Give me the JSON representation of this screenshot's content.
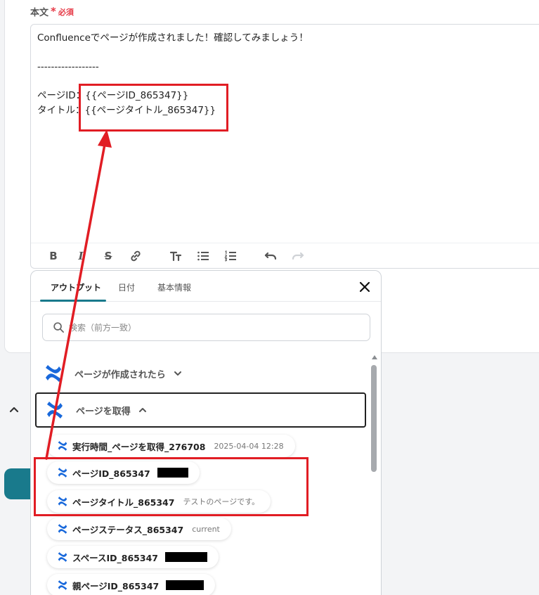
{
  "field": {
    "label": "本文",
    "asterisk": "*",
    "required": "必須"
  },
  "editor": {
    "text": "Confluenceでページが作成されました！確認してみましょう！\n\n------------------\n\nページID：{{ページID_865347}}\nタイトル：{{ページタイトル_865347}}"
  },
  "toolbar": {
    "bold": "B",
    "italic": "I",
    "strike": "S",
    "link": "link-icon",
    "heading": "heading-icon",
    "bullet": "bullet-list-icon",
    "number": "numbered-list-icon",
    "undo": "undo-icon",
    "redo": "redo-icon"
  },
  "panel": {
    "tabs": [
      "アウトプット",
      "日付",
      "基本情報"
    ],
    "search_placeholder": "検索（前方一致）",
    "groups": [
      {
        "label": "ページが作成されたら",
        "expanded": false
      },
      {
        "label": "ページを取得",
        "expanded": true
      }
    ],
    "items": [
      {
        "label": "実行時間_ページを取得_276708",
        "value": "2025-04-04 12:28"
      },
      {
        "label": "ページID_865347",
        "value": ""
      },
      {
        "label": "ページタイトル_865347",
        "value": "テストのページです。"
      },
      {
        "label": "ページステータス_865347",
        "value": "current"
      },
      {
        "label": "スペースID_865347",
        "value": ""
      },
      {
        "label": "親ページID_865347",
        "value": ""
      }
    ]
  },
  "colors": {
    "accent": "#197a8c",
    "required": "#e63946",
    "annotation": "#e11d24",
    "confluence_blue": "#1868db"
  }
}
